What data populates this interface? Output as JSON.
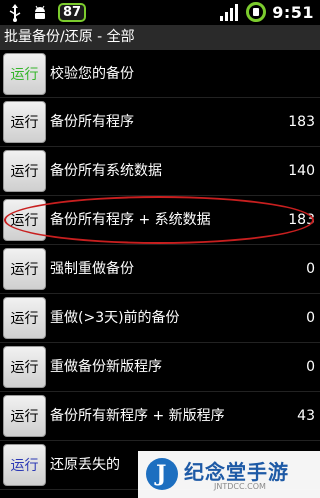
{
  "statusbar": {
    "usb_icon": "usb-icon",
    "android_icon": "android-debug-icon",
    "badge": "87",
    "signal_icon": "signal-strength-icon",
    "battery_icon": "battery-charging-icon",
    "time": "9:51",
    "accent": "#7ccc2e"
  },
  "title": "批量备份/还原 - 全部",
  "list": {
    "items": [
      {
        "button": "运行",
        "label": "校验您的备份",
        "count": ""
      },
      {
        "button": "运行",
        "label": "备份所有程序",
        "count": "183"
      },
      {
        "button": "运行",
        "label": "备份所有系统数据",
        "count": "140"
      },
      {
        "button": "运行",
        "label": "备份所有程序 + 系统数据",
        "count": "183"
      },
      {
        "button": "运行",
        "label": "强制重做备份",
        "count": "0"
      },
      {
        "button": "运行",
        "label": "重做(>3天)前的备份",
        "count": "0"
      },
      {
        "button": "运行",
        "label": "重做备份新版程序",
        "count": "0"
      },
      {
        "button": "运行",
        "label": "备份所有新程序 + 新版程序",
        "count": "43"
      },
      {
        "button": "运行",
        "label": "还原丢失的",
        "count": ""
      }
    ]
  },
  "highlight_color": "#c81f1f",
  "watermark": {
    "name": "纪念堂手游",
    "url": "JNTDCC.COM"
  }
}
